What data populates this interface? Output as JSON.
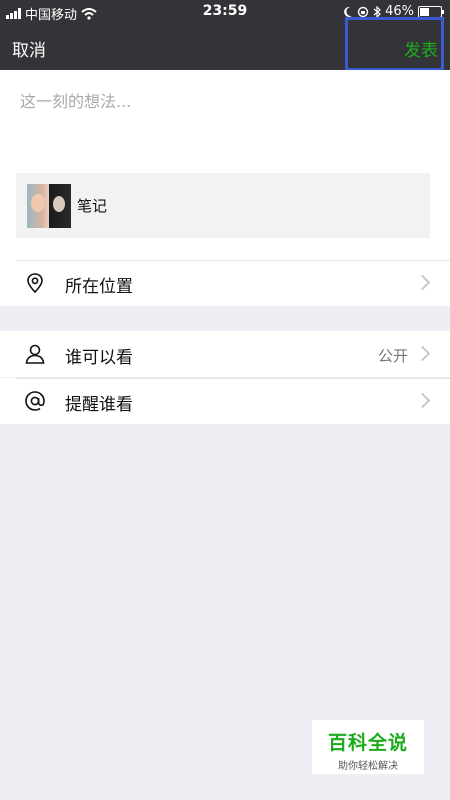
{
  "status_bar": {
    "carrier": "中国移动",
    "time": "23:59",
    "battery": "46%"
  },
  "nav": {
    "cancel_label": "取消",
    "publish_label": "发表"
  },
  "compose": {
    "placeholder": "这一刻的想法...",
    "attachment_label": "笔记"
  },
  "rows": {
    "location": {
      "label": "所在位置",
      "icon": "location-pin-icon"
    },
    "visibility": {
      "label": "谁可以看",
      "value": "公开",
      "icon": "person-icon"
    },
    "remind": {
      "label": "提醒谁看",
      "icon": "at-icon"
    }
  },
  "watermark": {
    "title": "百科全说",
    "subtitle": "助你轻松解决"
  },
  "colors": {
    "accent": "#1AAD19",
    "nav_bg": "#343438",
    "highlight": "#3A5BD0",
    "page_bg": "#EEEEF4"
  }
}
